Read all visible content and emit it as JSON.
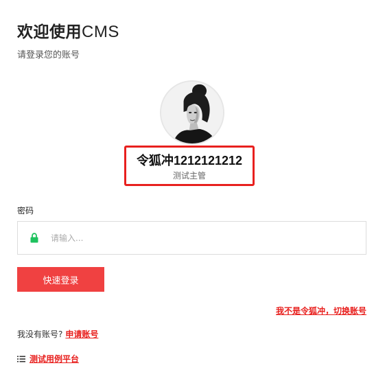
{
  "header": {
    "title_cn": "欢迎使用",
    "title_latin": "CMS",
    "subtitle": "请登录您的账号"
  },
  "user": {
    "name": "令狐冲",
    "id_number": "1212121212",
    "role": "测试主管"
  },
  "form": {
    "password_label": "密码",
    "password_placeholder": "请输入...",
    "password_value": "",
    "lock_icon": "lock-icon",
    "lock_icon_color": "#1ec25e",
    "submit_label": "快速登录"
  },
  "links": {
    "switch_account": "我不是令狐冲，切换账号",
    "register_prompt": "我没有账号?",
    "register_link": "申请账号",
    "platform_link": "测试用例平台",
    "platform_icon": "list-icon"
  },
  "colors": {
    "accent": "#f04141",
    "highlight_border": "#e8201e"
  }
}
